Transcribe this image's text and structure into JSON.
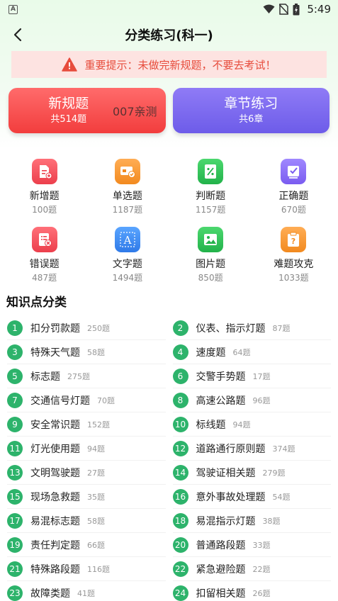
{
  "status_bar": {
    "time": "5:49",
    "app_icon_text": "A"
  },
  "nav": {
    "title": "分类练习(科一)",
    "back_icon": "chevron-left-icon"
  },
  "warning": {
    "text": "重要提示：未做完新规题，不要去考试！",
    "icon": "warning-triangle-icon"
  },
  "cards": [
    {
      "title": "新规题",
      "sub": "共514题",
      "overlay": "007亲测",
      "color": "#f23d3d"
    },
    {
      "title": "章节练习",
      "sub": "共6章",
      "color": "#6d5ce9"
    }
  ],
  "grid": [
    {
      "label": "新增题",
      "count": "100题",
      "icon": "new-doc-icon",
      "color": "#f0525e"
    },
    {
      "label": "单选题",
      "count": "1187题",
      "icon": "card-check-icon",
      "color": "#f59331"
    },
    {
      "label": "判断题",
      "count": "1157题",
      "icon": "percent-icon",
      "color": "#2ec35a"
    },
    {
      "label": "正确题",
      "count": "670题",
      "icon": "edit-check-icon",
      "color": "#8a6cf2"
    },
    {
      "label": "错误题",
      "count": "487题",
      "icon": "list-error-icon",
      "color": "#f0525e"
    },
    {
      "label": "文字题",
      "count": "1494题",
      "icon": "text-a-icon",
      "color": "#3d8ef2"
    },
    {
      "label": "图片题",
      "count": "850题",
      "icon": "image-icon",
      "color": "#2ec35a"
    },
    {
      "label": "难题攻克",
      "count": "1033题",
      "icon": "question-clipboard-icon",
      "color": "#f59331"
    }
  ],
  "section_title": "知识点分类",
  "knowledge_points": [
    {
      "num": "1",
      "name": "扣分罚款题",
      "count": "250题"
    },
    {
      "num": "2",
      "name": "仪表、指示灯题",
      "count": "87题"
    },
    {
      "num": "3",
      "name": "特殊天气题",
      "count": "58题"
    },
    {
      "num": "4",
      "name": "速度题",
      "count": "64题"
    },
    {
      "num": "5",
      "name": "标志题",
      "count": "275题"
    },
    {
      "num": "6",
      "name": "交警手势题",
      "count": "17题"
    },
    {
      "num": "7",
      "name": "交通信号灯题",
      "count": "70题"
    },
    {
      "num": "8",
      "name": "高速公路题",
      "count": "96题"
    },
    {
      "num": "9",
      "name": "安全常识题",
      "count": "152题"
    },
    {
      "num": "10",
      "name": "标线题",
      "count": "94题"
    },
    {
      "num": "11",
      "name": "灯光使用题",
      "count": "94题"
    },
    {
      "num": "12",
      "name": "道路通行原则题",
      "count": "374题"
    },
    {
      "num": "13",
      "name": "文明驾驶题",
      "count": "27题"
    },
    {
      "num": "14",
      "name": "驾驶证相关题",
      "count": "279题"
    },
    {
      "num": "15",
      "name": "现场急救题",
      "count": "35题"
    },
    {
      "num": "16",
      "name": "意外事故处理题",
      "count": "54题"
    },
    {
      "num": "17",
      "name": "易混标志题",
      "count": "58题"
    },
    {
      "num": "18",
      "name": "易混指示灯题",
      "count": "38题"
    },
    {
      "num": "19",
      "name": "责任判定题",
      "count": "66题"
    },
    {
      "num": "20",
      "name": "普通路段题",
      "count": "33题"
    },
    {
      "num": "21",
      "name": "特殊路段题",
      "count": "116题"
    },
    {
      "num": "22",
      "name": "紧急避险题",
      "count": "22题"
    },
    {
      "num": "23",
      "name": "故障类题",
      "count": "41题"
    },
    {
      "num": "24",
      "name": "扣留相关题",
      "count": "26题"
    }
  ],
  "colors": {
    "accent_green": "#2db36b",
    "warning_red": "#e74c3c",
    "warning_bg": "#fde3e1"
  }
}
